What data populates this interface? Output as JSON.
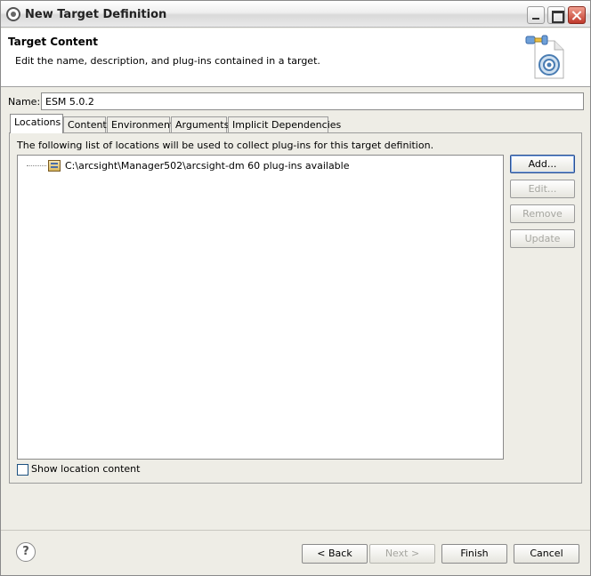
{
  "window": {
    "title": "New Target Definition"
  },
  "banner": {
    "title": "Target Content",
    "description": "Edit the name, description, and plug-ins contained in a target.",
    "image_icon": "target-definition-wizard-icon"
  },
  "name_field": {
    "label": "Name:",
    "value": "ESM 5.0.2"
  },
  "tabs": [
    {
      "label": "Locations",
      "active": true
    },
    {
      "label": "Content",
      "active": false
    },
    {
      "label": "Environment",
      "active": false
    },
    {
      "label": "Arguments",
      "active": false
    },
    {
      "label": "Implicit Dependencies",
      "active": false
    }
  ],
  "locations": {
    "description": "The following list of locations will be used to collect plug-ins for this target definition.",
    "items": [
      {
        "label": "C:\\arcsight\\Manager502\\arcsight-dm 60 plug-ins available",
        "icon": "directory-location-icon"
      }
    ],
    "buttons": {
      "add": "Add...",
      "edit": "Edit...",
      "remove": "Remove",
      "update": "Update"
    },
    "show_content_label": "Show location content",
    "show_content_checked": false
  },
  "footer": {
    "back": "< Back",
    "next": "Next >",
    "finish": "Finish",
    "cancel": "Cancel"
  }
}
